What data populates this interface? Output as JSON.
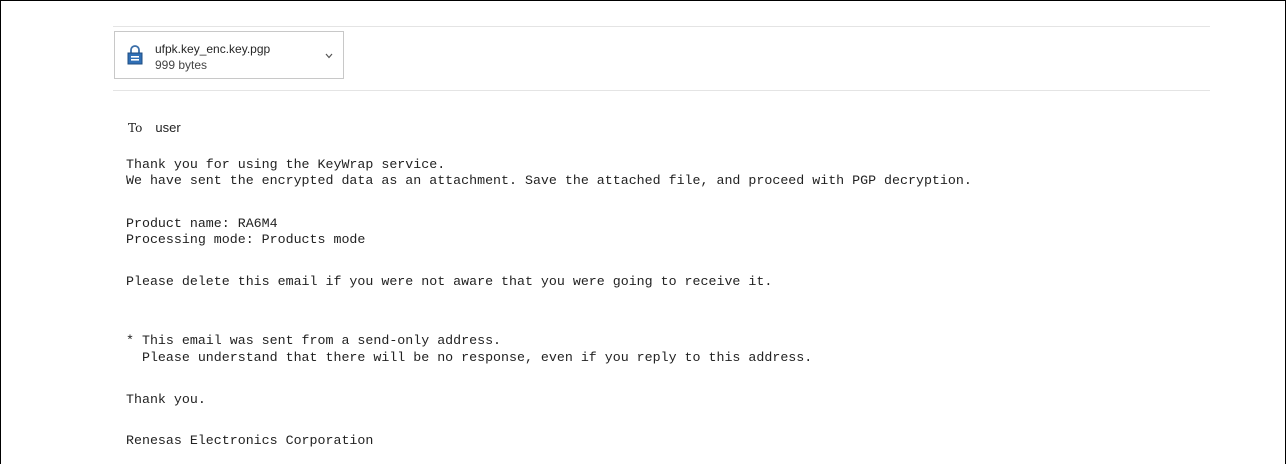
{
  "attachment": {
    "filename": "ufpk.key_enc.key.pgp",
    "size": "999 bytes"
  },
  "recipient": {
    "label": "To",
    "value": "user"
  },
  "body": {
    "line1": "Thank you for using the KeyWrap service.",
    "line2": "We have sent the encrypted data as an attachment. Save the attached file, and proceed with PGP decryption.",
    "line3": "Product name: RA6M4",
    "line4": "Processing mode: Products mode",
    "line5": "Please delete this email if you were not aware that you were going to receive it.",
    "line6": "* This email was sent from a send-only address.",
    "line7": "  Please understand that there will be no response, even if you reply to this address.",
    "line8": "Thank you.",
    "line9": "Renesas Electronics Corporation"
  }
}
